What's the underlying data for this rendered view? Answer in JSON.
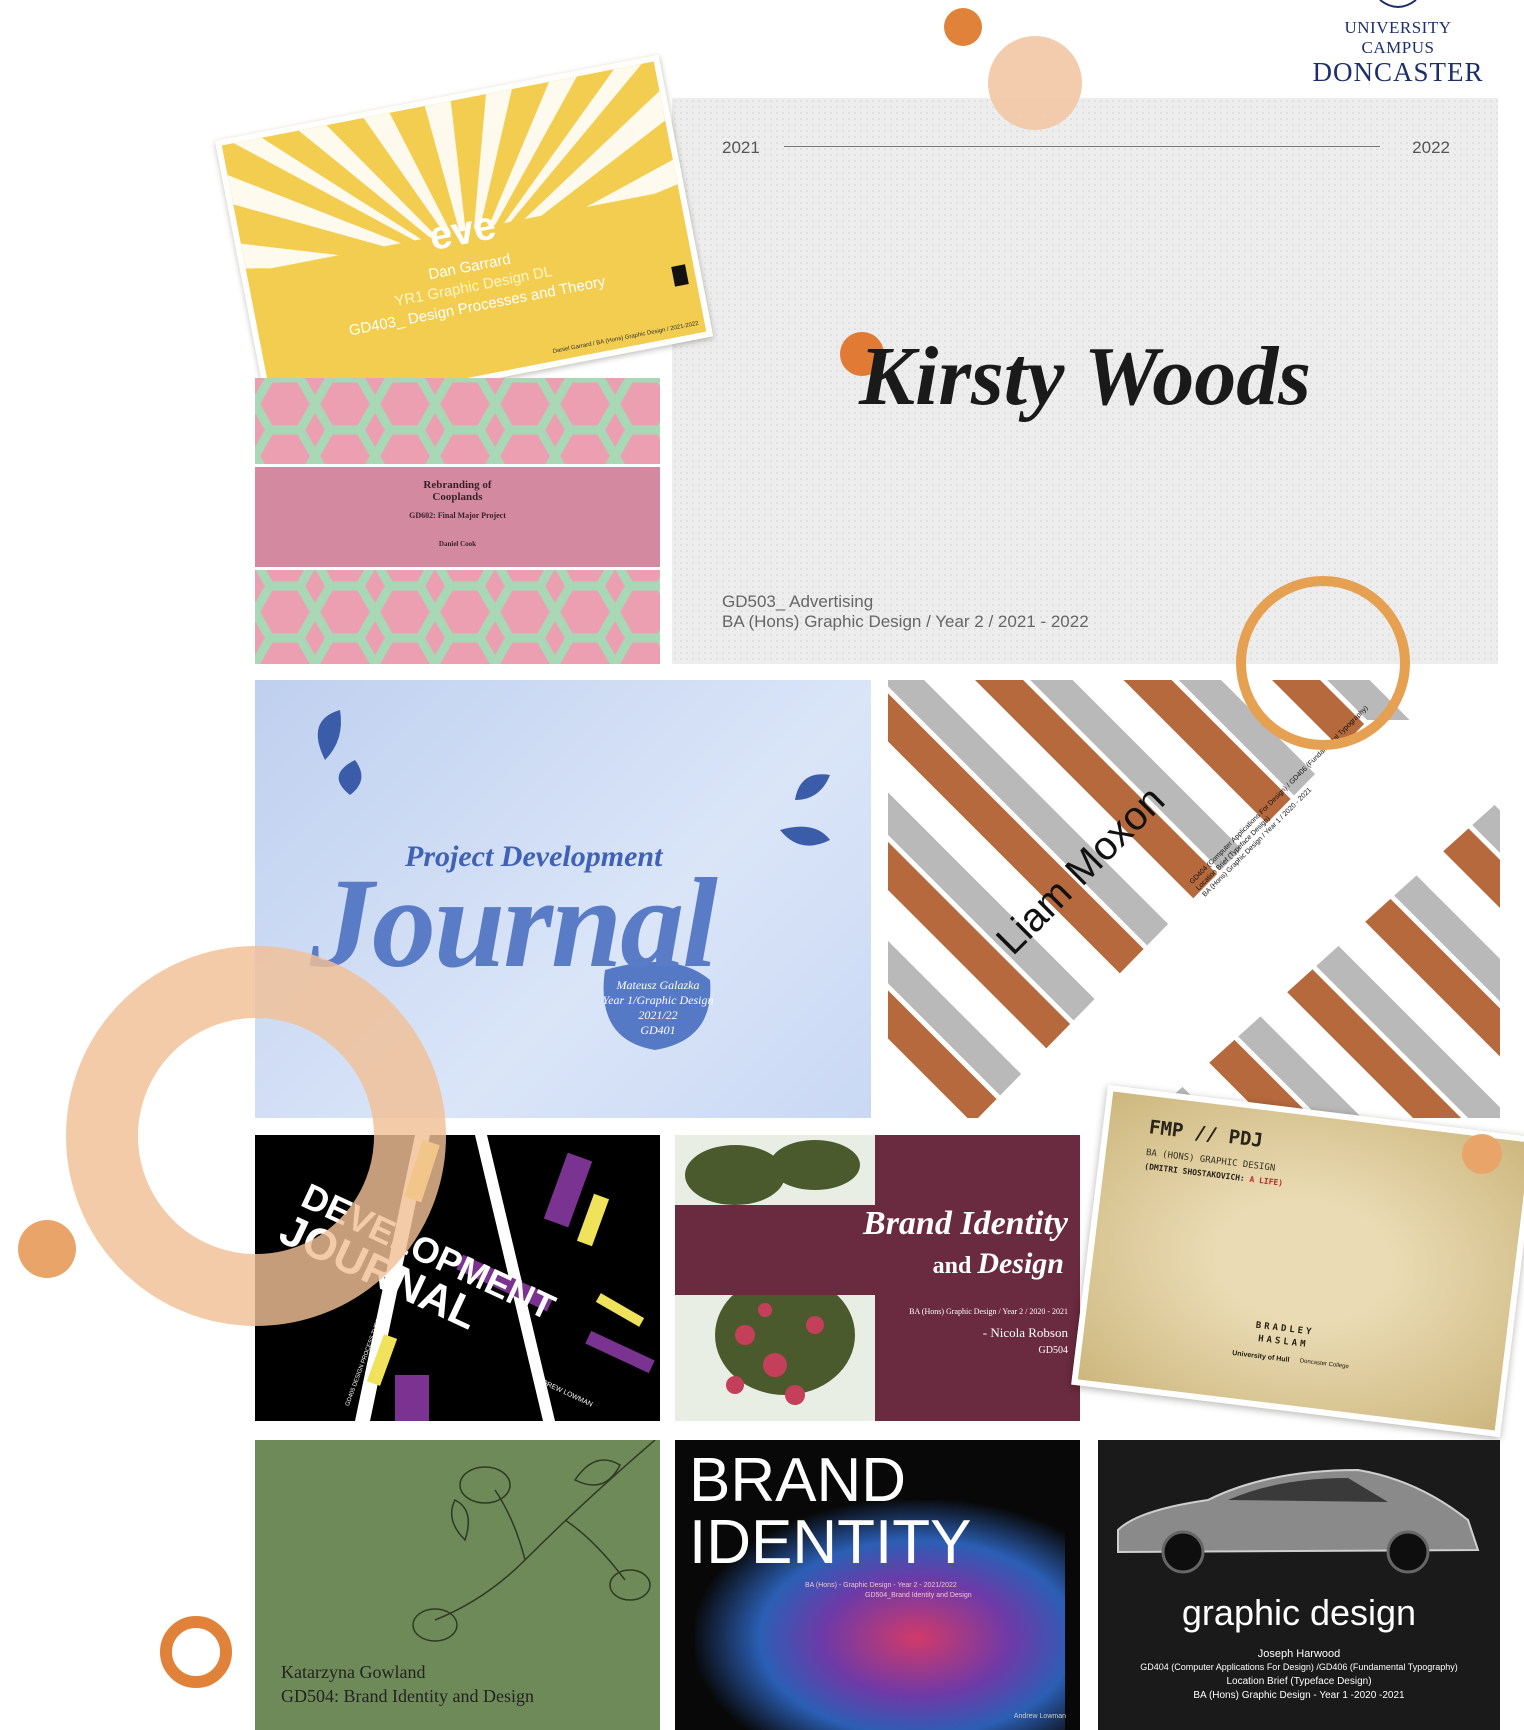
{
  "logo": {
    "line1": "UNIVERSITY CAMPUS",
    "line2": "DONCASTER"
  },
  "kirsty": {
    "year_start": "2021",
    "year_end": "2022",
    "name": "Kirsty Woods",
    "module": "GD503_ Advertising",
    "course": "BA (Hons) Graphic Design / Year 2 / 2021 - 2022"
  },
  "eve": {
    "logo": "eve",
    "author": "Dan Garrard",
    "course": "YR1 Graphic Design DL",
    "module": "GD403_ Design Processes and Theory",
    "footer": "Daniel Garrard / BA (Hons) Graphic Design / 2021-2022"
  },
  "cooplands": {
    "title1": "Rebranding of",
    "title2": "Cooplands",
    "module": "GD602: Final Major Project",
    "author": "Daniel Cook"
  },
  "journal": {
    "line1": "Project Development",
    "line2": "Journal",
    "author": "Mateusz Galazka",
    "course": "Year 1/Graphic Design",
    "year": "2021/22",
    "module": "GD401"
  },
  "liam": {
    "name": "Liam Moxon",
    "line1": "GD404 (Computer Applications For Design) / GD406 (Fundamental Typography)",
    "line2": "Location Brief (Typeface Design)",
    "line3": "BA (Hons) Graphic Design / Year 1 / 2020 - 2021"
  },
  "devj": {
    "word1": "DEVELOPMENT",
    "word2": "JOURNAL",
    "author": "ANDREW LOWMAN",
    "module": "GD405 DESIGN PROCESS THEORY"
  },
  "bid": {
    "title1": "Brand Identity",
    "title2a": "and ",
    "title2b": "Design",
    "course": "BA (Hons) Graphic Design / Year 2 / 2020 - 2021",
    "author": "- Nicola Robson",
    "module": "GD504"
  },
  "fmp": {
    "title": "FMP // PDJ",
    "course": "BA (HONS) GRAPHIC DESIGN",
    "subtitle_a": "(DMITRI SHOSTAKOVICH: ",
    "subtitle_b": "A LIFE)",
    "author1": "BRADLEY",
    "author2": "HASLAM",
    "uni": "University of Hull",
    "college": "Doncaster College"
  },
  "kat": {
    "author": "Katarzyna Gowland",
    "module": "GD504: Brand Identity and Design"
  },
  "bi2": {
    "word1": "BRAND",
    "word2": "IDENTITY",
    "course": "BA (Hons) - Graphic Design - Year 2 - 2021/2022",
    "module": "GD504_Brand Identity and Design",
    "author": "Andrew Lowman"
  },
  "gd": {
    "title": "graphic design",
    "author": "Joseph Harwood",
    "modules": "GD404 (Computer Applications For Design) /GD406 (Fundamental Typography)",
    "brief": "Location Brief (Typeface Design)",
    "course": "BA (Hons) Graphic Design - Year 1 -2020 -2021"
  },
  "colors": {
    "accent_orange": "#e0823a",
    "peach": "#f1c7a3",
    "navy": "#1c2f6b"
  }
}
